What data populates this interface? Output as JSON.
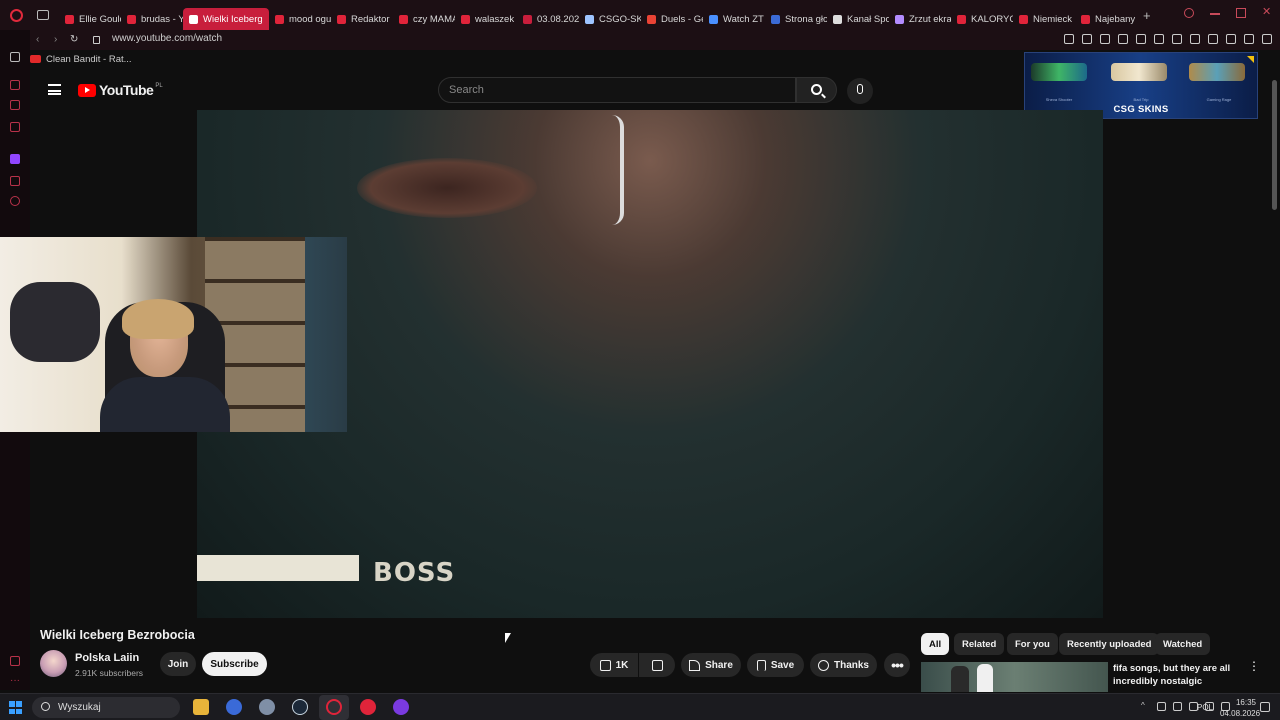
{
  "browser": {
    "tabs": [
      {
        "label": "Ellie Gould",
        "color": "#e0243a",
        "active": false
      },
      {
        "label": "brudas - Y",
        "color": "#e0243a",
        "active": false
      },
      {
        "label": "Wielki Iceberg",
        "color": "#ffffff",
        "active": true
      },
      {
        "label": "mood ogu",
        "color": "#e0243a",
        "active": false
      },
      {
        "label": "Redaktor",
        "color": "#e0243a",
        "active": false
      },
      {
        "label": "czy MAMA",
        "color": "#e0243a",
        "active": false
      },
      {
        "label": "walaszek",
        "color": "#e0243a",
        "active": false
      },
      {
        "label": "03.08.202",
        "color": "#c81e3c",
        "active": false
      },
      {
        "label": "CSGO-SK",
        "color": "#9ec4ff",
        "active": false
      },
      {
        "label": "Duels - Ge",
        "color": "#ea4335",
        "active": false
      },
      {
        "label": "Watch ZT",
        "color": "#4a90ff",
        "active": false
      },
      {
        "label": "Strona gło",
        "color": "#3b6bd6",
        "active": false
      },
      {
        "label": "Kanał Spo",
        "color": "#dddddd",
        "active": false
      },
      {
        "label": "Zrzut ekra",
        "color": "#b38cff",
        "active": false
      },
      {
        "label": "KALORYC",
        "color": "#e0243a",
        "active": false
      },
      {
        "label": "Niemieck",
        "color": "#e0243a",
        "active": false
      },
      {
        "label": "Najebany",
        "color": "#e0243a",
        "active": false
      }
    ],
    "new_tab": "+",
    "url": "www.youtube.com/watch",
    "bookmark": "Clean Bandit - Rat..."
  },
  "youtube": {
    "logo_text": "YouTube",
    "country": "PL",
    "search_placeholder": "Search",
    "ad_brand": "CSG SKINS",
    "ad_items": [
      "Sheva Shooter",
      "Bad Trip",
      "Gaming Rage"
    ],
    "video_overlay_text": "BOSS",
    "video_title": "Wielki Iceberg Bezrobocia",
    "channel_name": "Polska Laiin",
    "subscribers": "2.91K subscribers",
    "join_label": "Join",
    "subscribe_label": "Subscribe",
    "like_count": "1K",
    "share_label": "Share",
    "save_label": "Save",
    "thanks_label": "Thanks",
    "chips": [
      "All",
      "Related",
      "For you",
      "Recently uploaded",
      "Watched"
    ],
    "recommendation_title": "fifa songs, but they are all incredibly nostalgic"
  },
  "taskbar": {
    "search_label": "Wyszukaj",
    "language": "POL",
    "time": "16:35",
    "date": "04.08.2026"
  }
}
